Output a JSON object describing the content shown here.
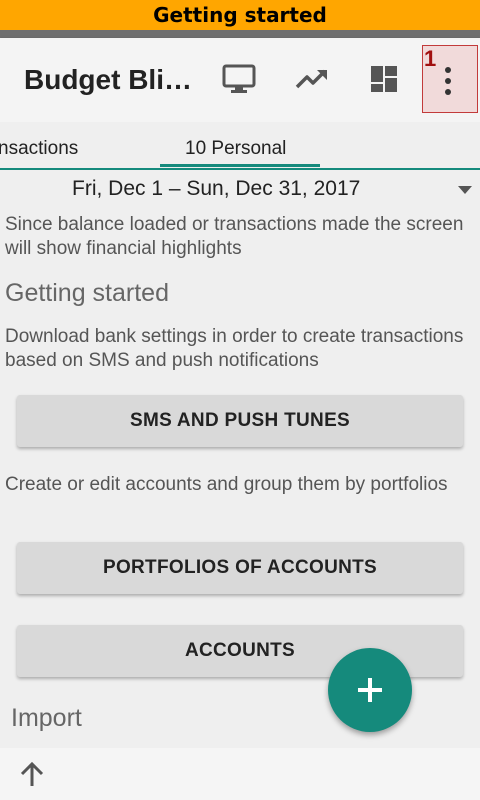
{
  "banner": {
    "title": "Getting started"
  },
  "appbar": {
    "title": "Budget Bli…",
    "menu_badge": "1",
    "icons": [
      "monitor-icon",
      "trending-up-icon",
      "dashboard-icon",
      "more-vert-icon"
    ]
  },
  "tabs": [
    {
      "label": "nsactions",
      "active": false
    },
    {
      "label": "10 Personal",
      "active": true
    }
  ],
  "date_range": "Fri, Dec 1 – Sun, Dec 31, 2017",
  "info_text": "Since balance loaded or transactions made the screen will show financial highlights",
  "getting_started": {
    "heading": "Getting started",
    "sms_desc": "Download bank settings in order to create transactions based on SMS and push notifications",
    "sms_button": "SMS AND PUSH TUNES",
    "accounts_desc": "Create or edit accounts and group them by portfolios",
    "portfolios_button": "PORTFOLIOS OF ACCOUNTS",
    "accounts_button": "ACCOUNTS"
  },
  "import_heading": "Import",
  "colors": {
    "banner": "#ffa600",
    "accent": "#158a7c",
    "button": "#d9d9d9"
  }
}
